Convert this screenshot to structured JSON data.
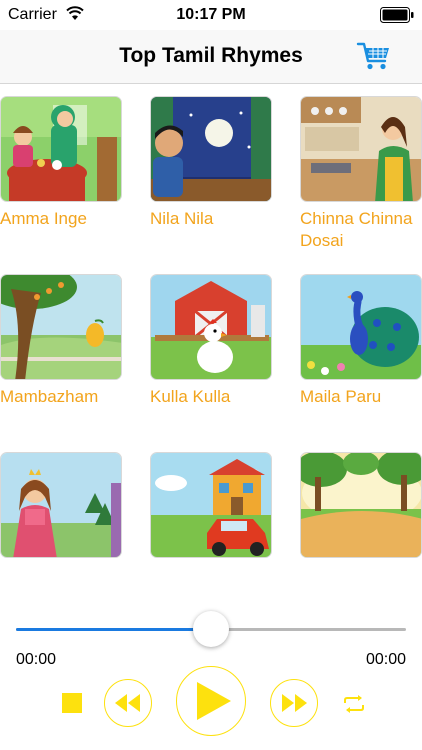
{
  "status_bar": {
    "carrier": "Carrier",
    "time": "10:17 PM"
  },
  "nav": {
    "title": "Top Tamil Rhymes",
    "cart_icon": "cart-icon"
  },
  "rhymes": [
    {
      "title": "Amma Inge",
      "thumbnail": "mother-and-child-at-table"
    },
    {
      "title": "Nila Nila",
      "thumbnail": "boy-looking-at-moon"
    },
    {
      "title": "Chinna Chinna Dosai",
      "thumbnail": "woman-in-kitchen"
    },
    {
      "title": "Mambazham",
      "thumbnail": "mango-tree"
    },
    {
      "title": "Kulla Kulla",
      "thumbnail": "hen-at-barn"
    },
    {
      "title": "Maila Paru",
      "thumbnail": "peacock"
    },
    {
      "title": "",
      "thumbnail": "princess"
    },
    {
      "title": "",
      "thumbnail": "car-and-house"
    },
    {
      "title": "",
      "thumbnail": "forest-path"
    }
  ],
  "player": {
    "current_time": "00:00",
    "duration": "00:00",
    "progress": 0.5,
    "accent_color": "#fde10e",
    "slider_color": "#1a7ae0",
    "controls": [
      "stop-icon",
      "rewind-icon",
      "play-icon",
      "fast-forward-icon",
      "repeat-icon"
    ]
  },
  "colors": {
    "label": "#f2a41d"
  }
}
